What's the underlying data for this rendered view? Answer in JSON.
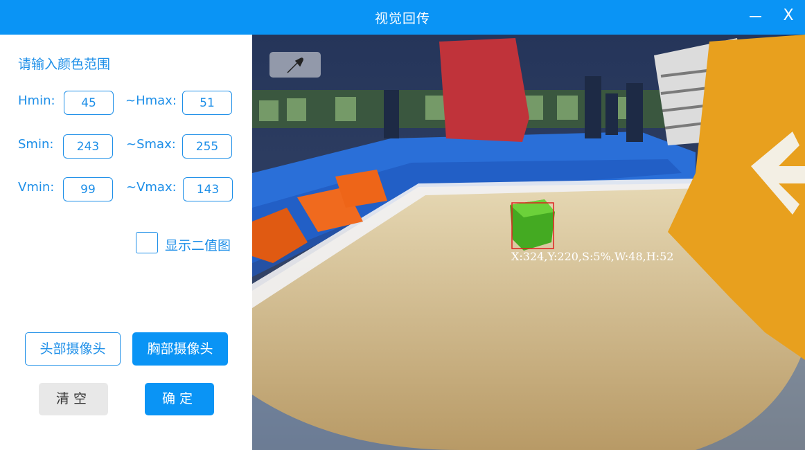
{
  "window": {
    "title": "视觉回传",
    "minimize_icon": "minimize-icon",
    "close_label": "X"
  },
  "panel": {
    "heading": "请输入颜色范围",
    "fields": {
      "hmin_label": "Hmin:",
      "hmin_value": "45",
      "hmax_label": "~Hmax:",
      "hmax_value": "51",
      "smin_label": "Smin:",
      "smin_value": "243",
      "smax_label": "~Smax:",
      "smax_value": "255",
      "vmin_label": "Vmin:",
      "vmin_value": "99",
      "vmax_label": "~Vmax:",
      "vmax_value": "143"
    },
    "binary_checkbox_label": "显示二值图",
    "binary_checked": false,
    "head_camera_label": "头部摄像头",
    "chest_camera_label": "胸部摄像头",
    "active_camera": "胸部摄像头",
    "clear_label": "清空",
    "confirm_label": "确定"
  },
  "camera": {
    "picker_icon": "eyedropper-icon",
    "detection_text": "X:324,Y:220,S:5%,W:48,H:52",
    "box_color": "#e02020"
  },
  "colors": {
    "accent": "#0a94f5",
    "text_blue": "#1e8fe8"
  }
}
